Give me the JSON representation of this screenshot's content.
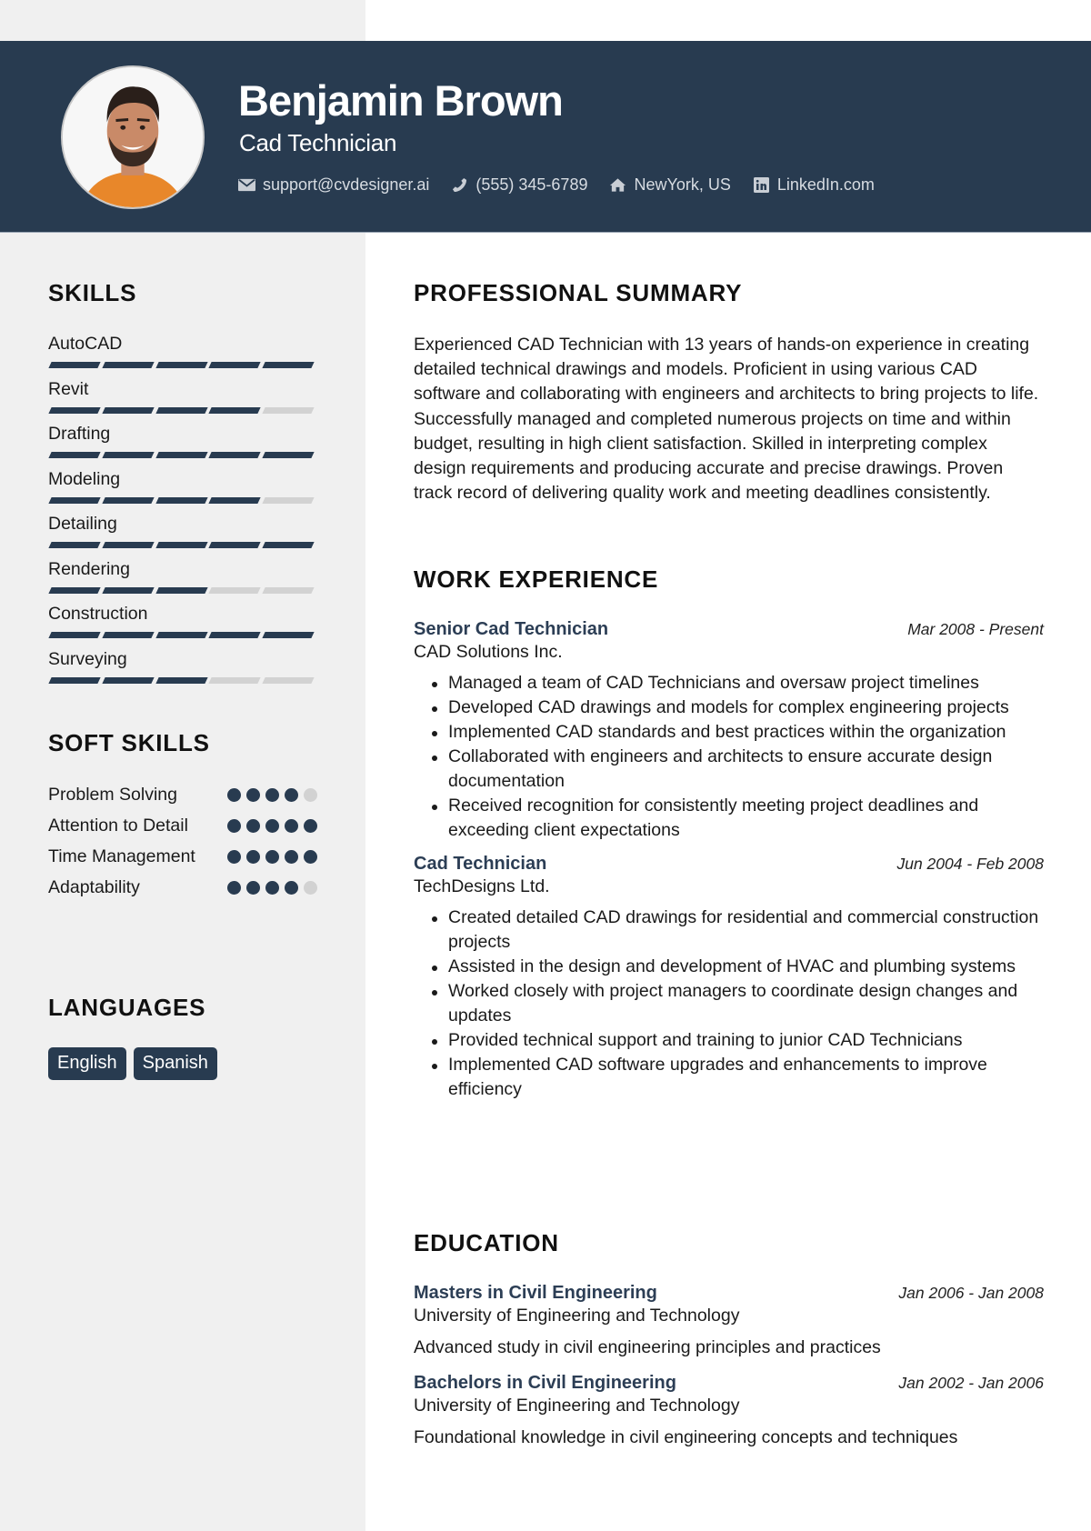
{
  "header": {
    "name": "Benjamin Brown",
    "title": "Cad Technician",
    "contacts": [
      {
        "icon": "envelope-icon",
        "label": "support@cvdesigner.ai"
      },
      {
        "icon": "phone-icon",
        "label": "(555) 345-6789"
      },
      {
        "icon": "home-icon",
        "label": "NewYork, US"
      },
      {
        "icon": "linkedin-icon",
        "label": "LinkedIn.com"
      }
    ]
  },
  "colors": {
    "accent": "#283b50",
    "sidebar_bg": "#f0f0f0",
    "inactive": "#d2d2d2",
    "heading_accent": "#2c3e55"
  },
  "skills": {
    "title": "SKILLS",
    "max_level": 5,
    "items": [
      {
        "name": "AutoCAD",
        "level": 5
      },
      {
        "name": "Revit",
        "level": 4
      },
      {
        "name": "Drafting",
        "level": 5
      },
      {
        "name": "Modeling",
        "level": 4
      },
      {
        "name": "Detailing",
        "level": 5
      },
      {
        "name": "Rendering",
        "level": 3
      },
      {
        "name": "Construction",
        "level": 5
      },
      {
        "name": "Surveying",
        "level": 3
      }
    ]
  },
  "soft_skills": {
    "title": "SOFT SKILLS",
    "max_level": 5,
    "items": [
      {
        "name": "Problem Solving",
        "level": 4
      },
      {
        "name": "Attention to Detail",
        "level": 5
      },
      {
        "name": "Time Management",
        "level": 5
      },
      {
        "name": "Adaptability",
        "level": 4
      }
    ]
  },
  "languages": {
    "title": "LANGUAGES",
    "items": [
      "English",
      "Spanish"
    ]
  },
  "summary": {
    "title": "PROFESSIONAL SUMMARY",
    "text": "Experienced CAD Technician with 13 years of hands-on experience in creating detailed technical drawings and models. Proficient in using various CAD software and collaborating with engineers and architects to bring projects to life. Successfully managed and completed numerous projects on time and within budget, resulting in high client satisfaction. Skilled in interpreting complex design requirements and producing accurate and precise drawings. Proven track record of delivering quality work and meeting deadlines consistently."
  },
  "work": {
    "title": "WORK EXPERIENCE",
    "jobs": [
      {
        "title": "Senior Cad Technician",
        "dates": "Mar 2008 - Present",
        "company": "CAD Solutions Inc.",
        "bullets": [
          "Managed a team of CAD Technicians and oversaw project timelines",
          "Developed CAD drawings and models for complex engineering projects",
          "Implemented CAD standards and best practices within the organization",
          "Collaborated with engineers and architects to ensure accurate design documentation",
          "Received recognition for consistently meeting project deadlines and exceeding client expectations"
        ]
      },
      {
        "title": "Cad Technician",
        "dates": "Jun 2004 - Feb 2008",
        "company": "TechDesigns Ltd.",
        "bullets": [
          "Created detailed CAD drawings for residential and commercial construction projects",
          "Assisted in the design and development of HVAC and plumbing systems",
          "Worked closely with project managers to coordinate design changes and updates",
          "Provided technical support and training to junior CAD Technicians",
          "Implemented CAD software upgrades and enhancements to improve efficiency"
        ]
      }
    ]
  },
  "education": {
    "title": "EDUCATION",
    "items": [
      {
        "degree": "Masters in Civil Engineering",
        "dates": "Jan 2006 - Jan 2008",
        "school": "University of Engineering and Technology",
        "description": "Advanced study in civil engineering principles and practices"
      },
      {
        "degree": "Bachelors in Civil Engineering",
        "dates": "Jan 2002 - Jan 2006",
        "school": "University of Engineering and Technology",
        "description": "Foundational knowledge in civil engineering concepts and techniques"
      }
    ]
  }
}
